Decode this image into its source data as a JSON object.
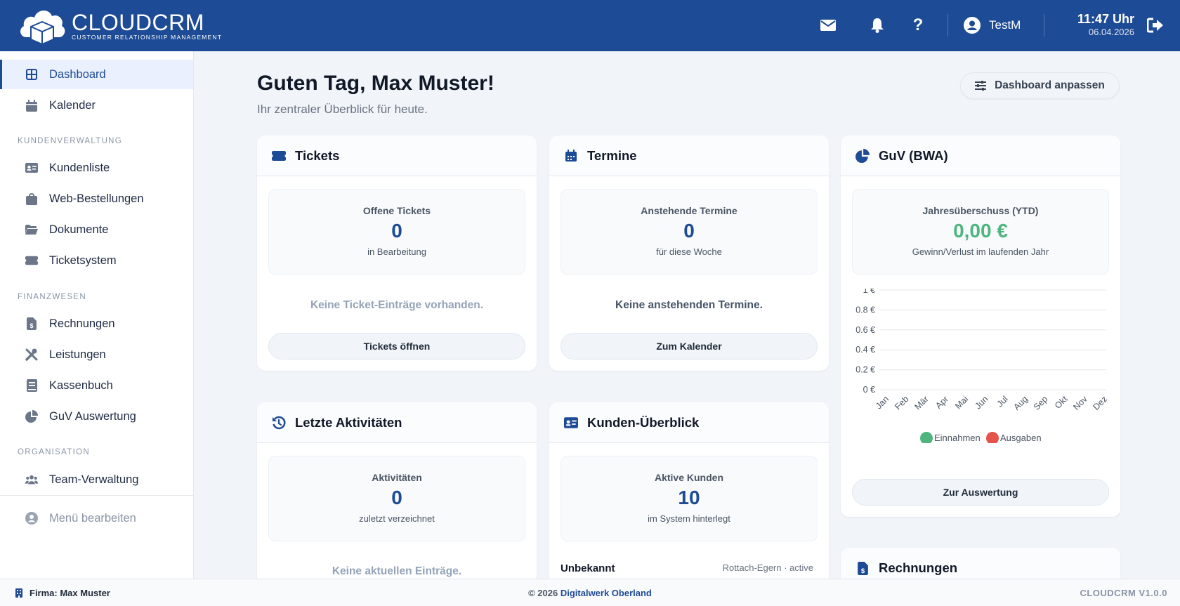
{
  "header": {
    "logo_title": "CLOUDCRM",
    "logo_subtitle": "CUSTOMER RELATIONSHIP MANAGEMENT",
    "user_name": "TestM",
    "time": "11:47 Uhr",
    "date": "06.04.2026",
    "icons": [
      "envelope-icon",
      "bell-icon",
      "question-icon",
      "user-circle-icon",
      "logout-icon"
    ]
  },
  "sidebar": {
    "items_top": [
      {
        "label": "Dashboard",
        "icon": "grid-icon",
        "active": true
      },
      {
        "label": "Kalender",
        "icon": "calendar-icon"
      }
    ],
    "section_customers": "KUNDENVERWALTUNG",
    "items_customers": [
      {
        "label": "Kundenliste",
        "icon": "id-card-icon"
      },
      {
        "label": "Web-Bestellungen",
        "icon": "shopping-bag-icon"
      },
      {
        "label": "Dokumente",
        "icon": "folder-open-icon"
      },
      {
        "label": "Ticketsystem",
        "icon": "ticket-icon"
      }
    ],
    "section_finance": "FINANZWESEN",
    "items_finance": [
      {
        "label": "Rechnungen",
        "icon": "invoice-icon"
      },
      {
        "label": "Leistungen",
        "icon": "tools-icon"
      },
      {
        "label": "Kassenbuch",
        "icon": "book-icon"
      },
      {
        "label": "GuV Auswertung",
        "icon": "pie-chart-icon"
      }
    ],
    "section_org": "ORGANISATION",
    "items_org": [
      {
        "label": "Team-Verwaltung",
        "icon": "users-icon"
      }
    ],
    "edit_menu": "Menü bearbeiten"
  },
  "main": {
    "greeting": "Guten Tag, Max Muster!",
    "subtitle": "Ihr zentraler Überblick für heute.",
    "customize_button": "Dashboard anpassen",
    "cards": {
      "tickets": {
        "title": "Tickets",
        "stat_label": "Offene Tickets",
        "stat_value": "0",
        "stat_sub": "in Bearbeitung",
        "empty": "Keine Ticket-Einträge vorhanden.",
        "button": "Tickets öffnen"
      },
      "termine": {
        "title": "Termine",
        "stat_label": "Anstehende Termine",
        "stat_value": "0",
        "stat_sub": "für diese Woche",
        "empty": "Keine anstehenden Termine.",
        "button": "Zum Kalender"
      },
      "guv": {
        "title": "GuV (BWA)",
        "stat_label": "Jahresüberschuss (YTD)",
        "stat_value": "0,00 €",
        "stat_sub": "Gewinn/Verlust im laufenden Jahr",
        "button": "Zur Auswertung"
      },
      "aktivitaeten": {
        "title": "Letzte Aktivitäten",
        "stat_label": "Aktivitäten",
        "stat_value": "0",
        "stat_sub": "zuletzt verzeichnet",
        "empty": "Keine aktuellen Einträge."
      },
      "kunden": {
        "title": "Kunden-Überblick",
        "stat_label": "Aktive Kunden",
        "stat_value": "10",
        "stat_sub": "im System hinterlegt",
        "row_name": "Unbekannt",
        "row_meta": "Rottach-Egern · active"
      },
      "rechnungen": {
        "title": "Rechnungen"
      }
    }
  },
  "chart_data": {
    "type": "line",
    "categories": [
      "Jan",
      "Feb",
      "Mär",
      "Apr",
      "Mai",
      "Jun",
      "Jul",
      "Aug",
      "Sep",
      "Okt",
      "Nov",
      "Dez"
    ],
    "y_ticks": [
      "0 €",
      "0.2 €",
      "0.4 €",
      "0.6 €",
      "0.8 €",
      "1 €"
    ],
    "ylim": [
      0,
      1
    ],
    "grid": true,
    "legend_position": "bottom",
    "series": [
      {
        "name": "Einnahmen",
        "color": "#4fb57f",
        "values": [
          0,
          0,
          0,
          0,
          0,
          0,
          0,
          0,
          0,
          0,
          0,
          0
        ]
      },
      {
        "name": "Ausgaben",
        "color": "#e5534b",
        "values": [
          0,
          0,
          0,
          0,
          0,
          0,
          0,
          0,
          0,
          0,
          0,
          0
        ]
      }
    ]
  },
  "footer": {
    "company": "Firma: Max Muster",
    "copyright_prefix": "© 2026",
    "copyright_link": "Digitalwerk Oberland",
    "version": "CLOUDCRM V1.0.0"
  },
  "colors": {
    "brand": "#1e4b95",
    "positive": "#4fb57f",
    "negative": "#e5534b",
    "background": "#f1f5f9"
  }
}
